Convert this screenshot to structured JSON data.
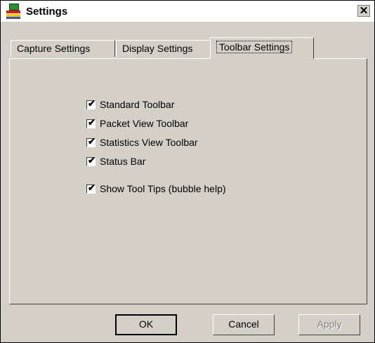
{
  "window": {
    "title": "Settings",
    "close_glyph": "✕"
  },
  "tabs": [
    {
      "label": "Capture Settings",
      "active": false
    },
    {
      "label": "Display Settings",
      "active": false
    },
    {
      "label": "Toolbar Settings",
      "active": true
    }
  ],
  "toolbar_settings": {
    "options": [
      {
        "label": "Standard Toolbar",
        "checked": true
      },
      {
        "label": "Packet View Toolbar",
        "checked": true
      },
      {
        "label": "Statistics View Toolbar",
        "checked": true
      },
      {
        "label": "Status Bar",
        "checked": true
      },
      {
        "label": "Show Tool Tips (bubble help)",
        "checked": true
      }
    ]
  },
  "buttons": {
    "ok": "OK",
    "cancel": "Cancel",
    "apply": "Apply"
  },
  "icons": {
    "app": "app-icon",
    "check": "✔"
  }
}
